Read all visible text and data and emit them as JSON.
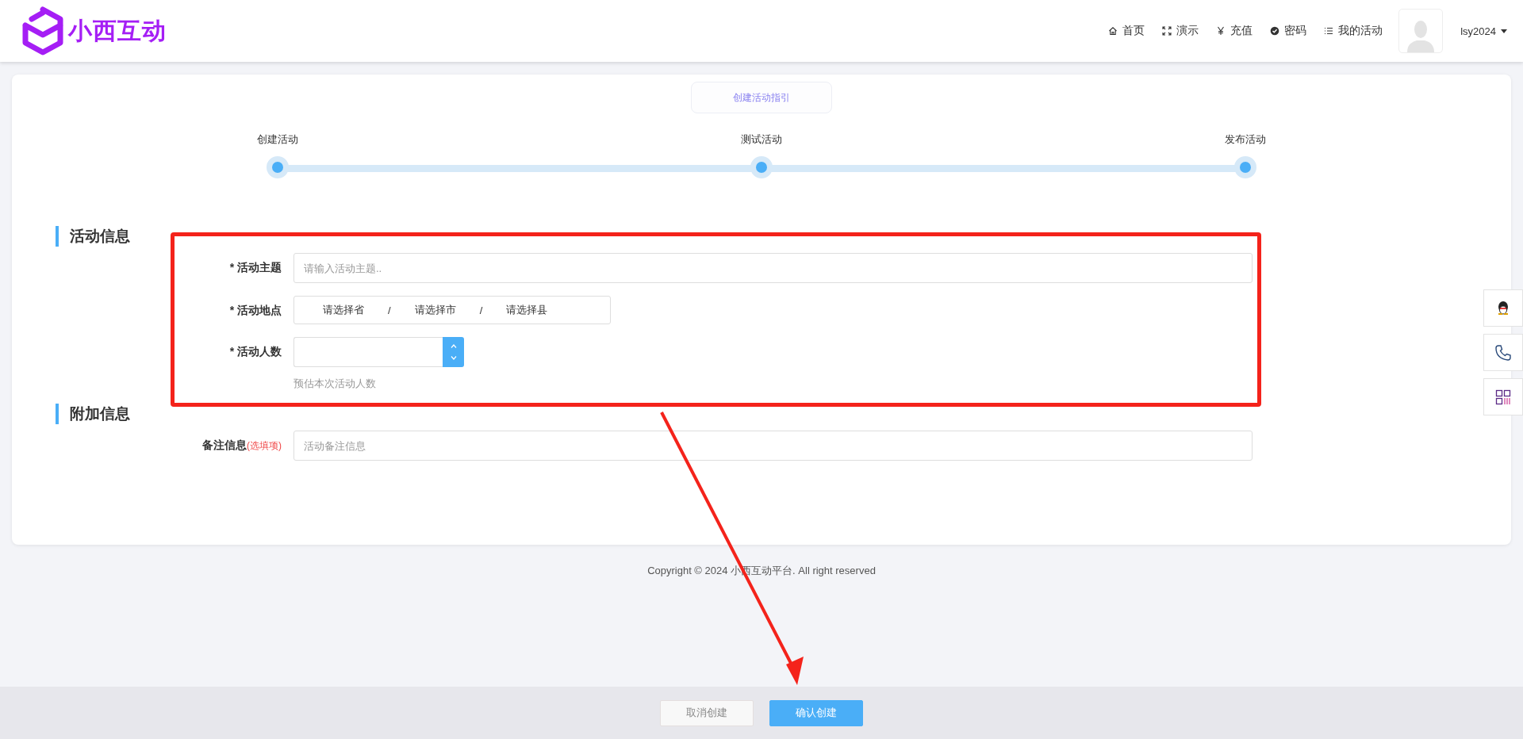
{
  "header": {
    "logo_text": "小西互动",
    "nav": [
      {
        "kind": "home",
        "label": "首页"
      },
      {
        "kind": "demo",
        "label": "演示"
      },
      {
        "kind": "recharge",
        "label": "充值"
      },
      {
        "kind": "password",
        "label": "密码"
      },
      {
        "kind": "list",
        "label": "我的活动"
      }
    ],
    "username": "lsy2024"
  },
  "guide_button": "创建活动指引",
  "steps": [
    {
      "label": "创建活动"
    },
    {
      "label": "测试活动"
    },
    {
      "label": "发布活动"
    }
  ],
  "sections": [
    {
      "title": "活动信息",
      "fields": [
        {
          "kind": "text",
          "label": "* 活动主题",
          "placeholder": "请输入活动主题.."
        },
        {
          "kind": "region",
          "label": "* 活动地点",
          "options": [
            "请选择省",
            "请选择市",
            "请选择县"
          ],
          "separators": [
            "/",
            "/"
          ]
        },
        {
          "kind": "number",
          "label": "* 活动人数",
          "hint": "预估本次活动人数"
        }
      ]
    },
    {
      "title": "附加信息",
      "fields": [
        {
          "kind": "text",
          "label": "备注信息",
          "optional_note": "(选填项)",
          "placeholder": "活动备注信息"
        }
      ]
    }
  ],
  "copyright": "Copyright © 2024 小西互动平台. All right reserved",
  "buttons": [
    {
      "kind": "cancel",
      "label": "取消创建"
    },
    {
      "kind": "confirm",
      "label": "确认创建"
    }
  ]
}
